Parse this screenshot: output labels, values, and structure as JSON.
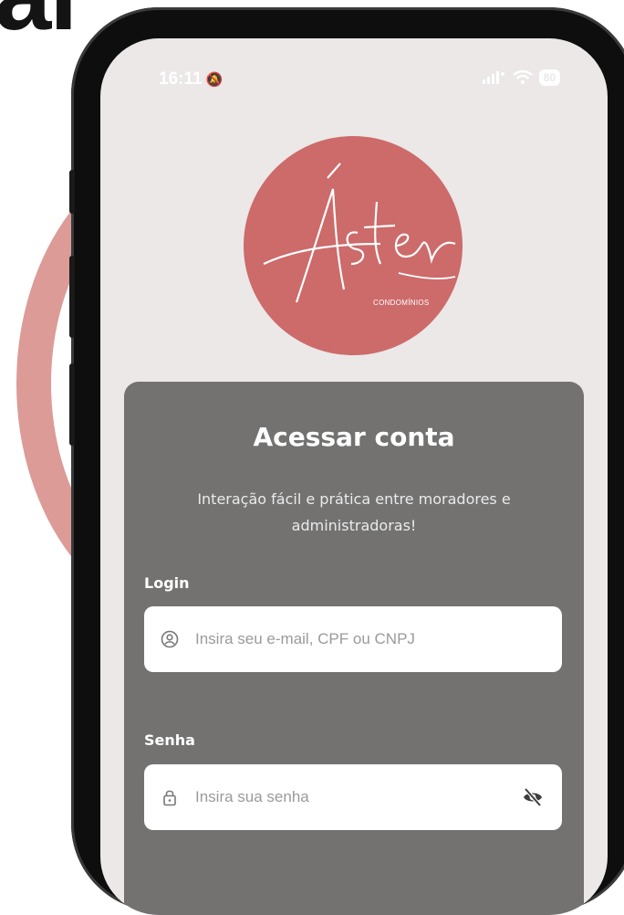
{
  "background": {
    "heading_fragment": "al",
    "accent_color": "#dc9b97"
  },
  "status_bar": {
    "time": "16:11",
    "silent_icon": "bell-slash-icon",
    "battery_level": "80"
  },
  "logo": {
    "script_text": "Áster",
    "subtitle": "CONDOMÍNIOS",
    "color": "#cd6a6a"
  },
  "login_card": {
    "title": "Acessar conta",
    "subtitle": "Interação fácil e prática entre moradores e administradoras!",
    "login_label": "Login",
    "login_placeholder": "Insira seu e-mail, CPF ou CNPJ",
    "password_label": "Senha",
    "password_placeholder": "Insira sua senha",
    "card_color": "#737271"
  }
}
